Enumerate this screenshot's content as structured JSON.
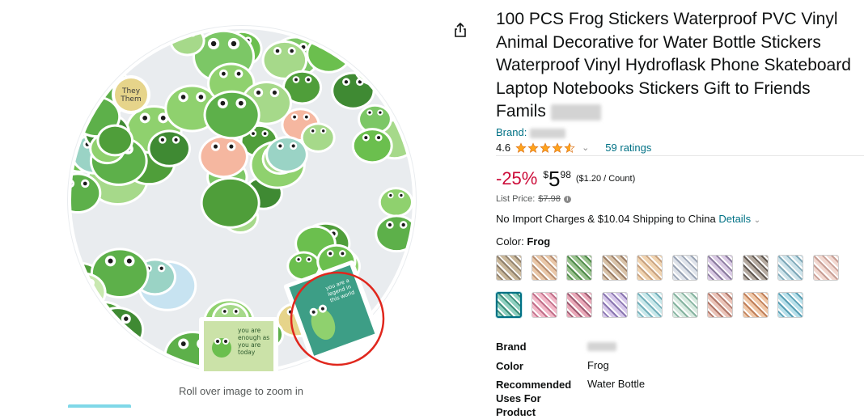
{
  "image": {
    "caption": "Roll over image to zoom in",
    "badge_tag_text": "They Them",
    "card_left_text": "you are enough as you are today",
    "card_right_text": "you are a legend in this world"
  },
  "product": {
    "title": "100 PCS Frog Stickers Waterproof PVC Vinyl Animal Decorative for Water Bottle Stickers Waterproof Vinyl Hydroflask Phone Skateboard Laptop Notebooks Stickers Gift to Friends Famils",
    "brand_label": "Brand:",
    "rating_value": "4.6",
    "rating_stars": 4.6,
    "ratings_count": "59 ratings",
    "discount": "-25%",
    "price_symbol": "$",
    "price_whole": "5",
    "price_fraction": "98",
    "unit_price": "($1.20 / Count)",
    "list_price_label": "List Price:",
    "list_price": "$7.98",
    "shipping_text": "No Import Charges & $10.04 Shipping to China",
    "details_link": "Details",
    "color_label": "Color:",
    "color_value": "Frog"
  },
  "swatches": [
    {
      "name": "swatch-1",
      "c1": "#c9b79a",
      "c2": "#8e7f6b"
    },
    {
      "name": "swatch-2",
      "c1": "#e9c7a8",
      "c2": "#b88f72"
    },
    {
      "name": "swatch-3",
      "c1": "#9ac28f",
      "c2": "#4f8a4a"
    },
    {
      "name": "swatch-4",
      "c1": "#d8c2a8",
      "c2": "#9a7d66"
    },
    {
      "name": "swatch-5",
      "c1": "#f0d3b0",
      "c2": "#c7a17f"
    },
    {
      "name": "swatch-6",
      "c1": "#dfe3ea",
      "c2": "#9aa4b5"
    },
    {
      "name": "swatch-7",
      "c1": "#d9c9e3",
      "c2": "#8a7a9e"
    },
    {
      "name": "swatch-8",
      "c1": "#b5aaa0",
      "c2": "#5f564f"
    },
    {
      "name": "swatch-9",
      "c1": "#cde3ea",
      "c2": "#7ea8b8"
    },
    {
      "name": "swatch-10",
      "c1": "#f2d8d0",
      "c2": "#c79e95"
    },
    {
      "name": "swatch-11",
      "c1": "#8fd0c0",
      "c2": "#3d8e7a",
      "selected": true
    },
    {
      "name": "swatch-12",
      "c1": "#f2b8c8",
      "c2": "#c1708a"
    },
    {
      "name": "swatch-13",
      "c1": "#e9a8b8",
      "c2": "#9e5c72"
    },
    {
      "name": "swatch-14",
      "c1": "#d6c7ea",
      "c2": "#8a76b0"
    },
    {
      "name": "swatch-15",
      "c1": "#c8e8ea",
      "c2": "#74b0bb"
    },
    {
      "name": "swatch-16",
      "c1": "#d8eae0",
      "c2": "#86b3a0"
    },
    {
      "name": "swatch-17",
      "c1": "#eac3b8",
      "c2": "#b0776a"
    },
    {
      "name": "swatch-18",
      "c1": "#f0c8a8",
      "c2": "#c0805a"
    },
    {
      "name": "swatch-19",
      "c1": "#b8e0ea",
      "c2": "#5aa0b5"
    }
  ],
  "details": [
    {
      "label": "Brand",
      "value": ""
    },
    {
      "label": "Color",
      "value": "Frog"
    },
    {
      "label": "Recommended Uses For Product",
      "value": "Water Bottle"
    }
  ],
  "colors": {
    "link": "#007185",
    "discount": "#cc0c39",
    "star": "#ffa41c",
    "annotation_circle": "#e0271d",
    "sticker_green": "#6bbf4e"
  }
}
